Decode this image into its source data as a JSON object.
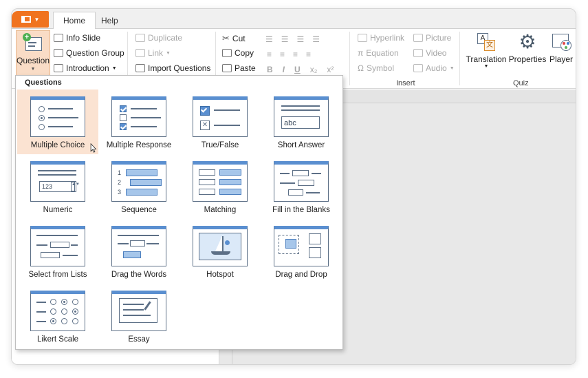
{
  "tabs": {
    "home": "Home",
    "help": "Help"
  },
  "ribbon": {
    "question": "Question",
    "info_slide": "Info Slide",
    "question_group": "Question Group",
    "introduction": "Introduction",
    "duplicate": "Duplicate",
    "link": "Link",
    "import_questions": "Import Questions",
    "cut": "Cut",
    "copy": "Copy",
    "paste": "Paste",
    "bold": "B",
    "italic": "I",
    "underline": "U",
    "subscript": "x₂",
    "superscript": "x²",
    "hyperlink": "Hyperlink",
    "equation": "Equation",
    "symbol": "Symbol",
    "picture": "Picture",
    "video": "Video",
    "audio": "Audio",
    "insert_group": "Insert",
    "translation": "Translation",
    "properties": "Properties",
    "player": "Player",
    "quiz_group": "Quiz"
  },
  "dropdown": {
    "title": "Questions",
    "items": [
      "Multiple Choice",
      "Multiple Response",
      "True/False",
      "Short Answer",
      "Numeric",
      "Sequence",
      "Matching",
      "Fill in the Blanks",
      "Select from Lists",
      "Drag the Words",
      "Hotspot",
      "Drag and Drop",
      "Likert Scale",
      "Essay"
    ],
    "selected": "Multiple Choice"
  },
  "thumb_text": {
    "short_answer": "abc",
    "numeric": "123",
    "seq1": "1",
    "seq2": "2",
    "seq3": "3"
  },
  "colors": {
    "accent": "#f0731f",
    "selection": "#fbe3d2",
    "thumb_header": "#5a8fd0"
  }
}
